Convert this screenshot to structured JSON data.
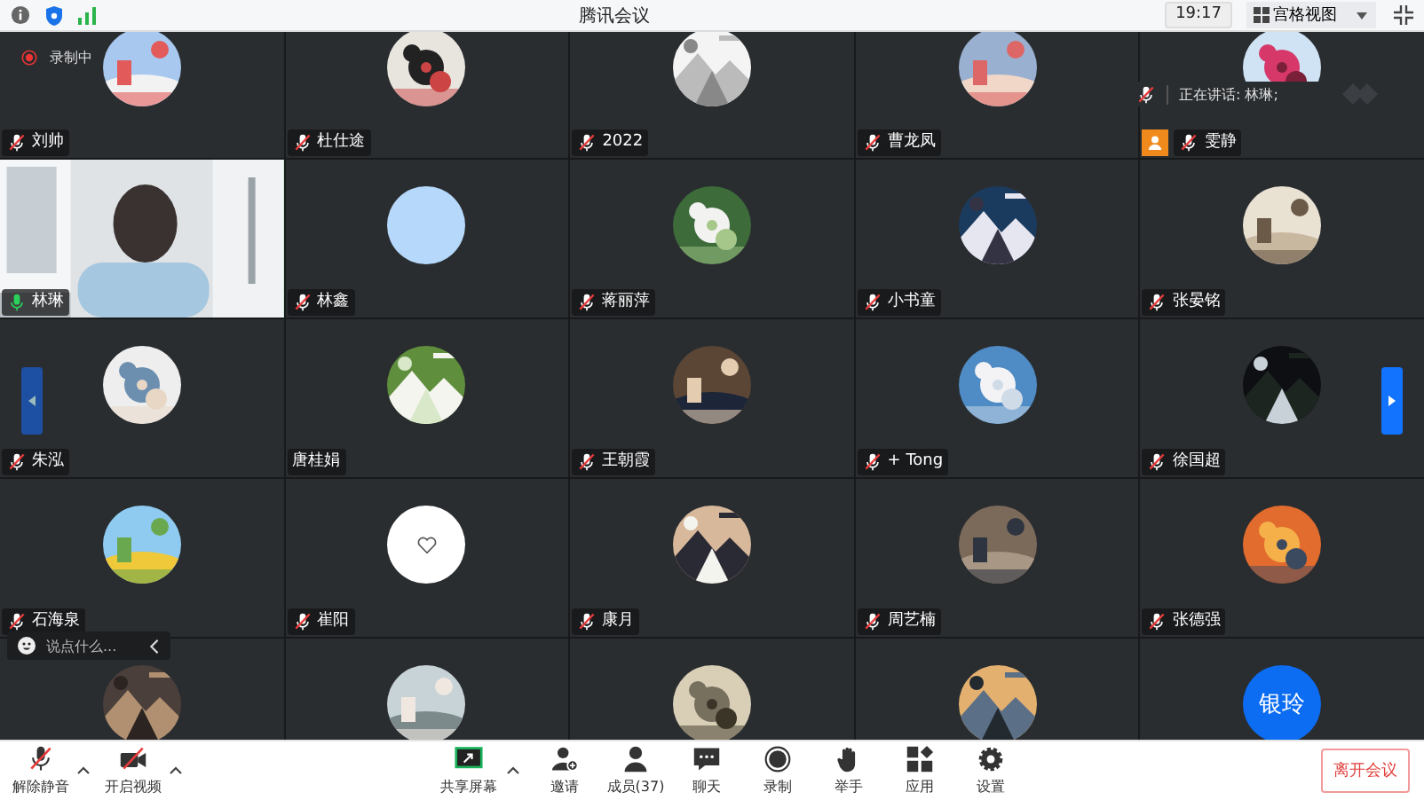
{
  "top_bar": {
    "title": "腾讯会议",
    "time": "19:17",
    "view_button": "宫格视图"
  },
  "recording": {
    "label": "录制中"
  },
  "speaker": {
    "label": "正在讲话: 林琳;"
  },
  "tiles": [
    {
      "name": "刘帅",
      "kind": "picture",
      "mic": true,
      "muted": true,
      "host": false,
      "speaking": false
    },
    {
      "name": "杜仕途",
      "kind": "picture",
      "mic": true,
      "muted": true,
      "host": false,
      "speaking": false
    },
    {
      "name": "2022",
      "kind": "picture",
      "mic": true,
      "muted": true,
      "host": false,
      "speaking": false
    },
    {
      "name": "曹龙凤",
      "kind": "picture",
      "mic": true,
      "muted": true,
      "host": false,
      "speaking": false
    },
    {
      "name": "雯静",
      "kind": "picture",
      "mic": true,
      "muted": true,
      "host": true,
      "speaking": false
    },
    {
      "name": "林琳",
      "kind": "video",
      "mic": true,
      "muted": false,
      "host": false,
      "speaking": true
    },
    {
      "name": "林鑫",
      "kind": "color",
      "color": "#b5d8fb",
      "mic": true,
      "muted": true,
      "host": false,
      "speaking": false
    },
    {
      "name": "蒋丽萍",
      "kind": "picture",
      "mic": true,
      "muted": true,
      "host": false,
      "speaking": false
    },
    {
      "name": "小书童",
      "kind": "picture",
      "mic": true,
      "muted": true,
      "host": false,
      "speaking": false
    },
    {
      "name": "张晏铭",
      "kind": "picture",
      "mic": true,
      "muted": true,
      "host": false,
      "speaking": false
    },
    {
      "name": "朱泓",
      "kind": "picture",
      "mic": true,
      "muted": true,
      "host": false,
      "speaking": false
    },
    {
      "name": "唐桂娟",
      "kind": "picture",
      "mic": false,
      "host": false
    },
    {
      "name": "王朝霞",
      "kind": "picture",
      "mic": true,
      "muted": true,
      "host": false,
      "speaking": false
    },
    {
      "name": "+ Tong",
      "kind": "picture",
      "mic": true,
      "muted": true,
      "host": false,
      "speaking": false
    },
    {
      "name": "徐国超",
      "kind": "picture",
      "mic": true,
      "muted": true,
      "host": false,
      "speaking": false
    },
    {
      "name": "石海泉",
      "kind": "picture",
      "mic": true,
      "muted": true,
      "host": false,
      "speaking": false
    },
    {
      "name": "崔阳",
      "kind": "heart",
      "mic": true,
      "muted": true,
      "host": false,
      "speaking": false
    },
    {
      "name": "康月",
      "kind": "picture",
      "mic": true,
      "muted": true,
      "host": false,
      "speaking": false
    },
    {
      "name": "周艺楠",
      "kind": "picture",
      "mic": true,
      "muted": true,
      "host": false,
      "speaking": false
    },
    {
      "name": "张德强",
      "kind": "picture",
      "mic": true,
      "muted": true,
      "host": false,
      "speaking": false
    },
    {
      "kind": "picture"
    },
    {
      "kind": "picture"
    },
    {
      "kind": "picture"
    },
    {
      "kind": "picture"
    },
    {
      "kind": "initials",
      "avatar_text": "银玲",
      "color": "#0c6cf2"
    }
  ],
  "chat": {
    "placeholder": "说点什么..."
  },
  "toolbar": {
    "left": [
      {
        "kind": "mic",
        "label": "解除静音",
        "off": true,
        "caret": true
      },
      {
        "kind": "camera",
        "label": "开启视频",
        "off": true,
        "caret": true
      }
    ],
    "center": [
      {
        "kind": "share",
        "label": "共享屏幕",
        "off": false,
        "caret": true
      },
      {
        "kind": "invite",
        "label": "邀请",
        "off": false,
        "caret": false
      },
      {
        "kind": "members",
        "label": "成员(37)",
        "off": false,
        "caret": false
      },
      {
        "kind": "chat",
        "label": "聊天",
        "off": false,
        "caret": false
      },
      {
        "kind": "record",
        "label": "录制",
        "off": false,
        "caret": false
      },
      {
        "kind": "hand",
        "label": "举手",
        "off": false,
        "caret": false
      },
      {
        "kind": "apps",
        "label": "应用",
        "off": false,
        "caret": false
      },
      {
        "kind": "settings",
        "label": "设置",
        "off": false,
        "caret": false
      }
    ],
    "leave_button": "离开会议"
  }
}
